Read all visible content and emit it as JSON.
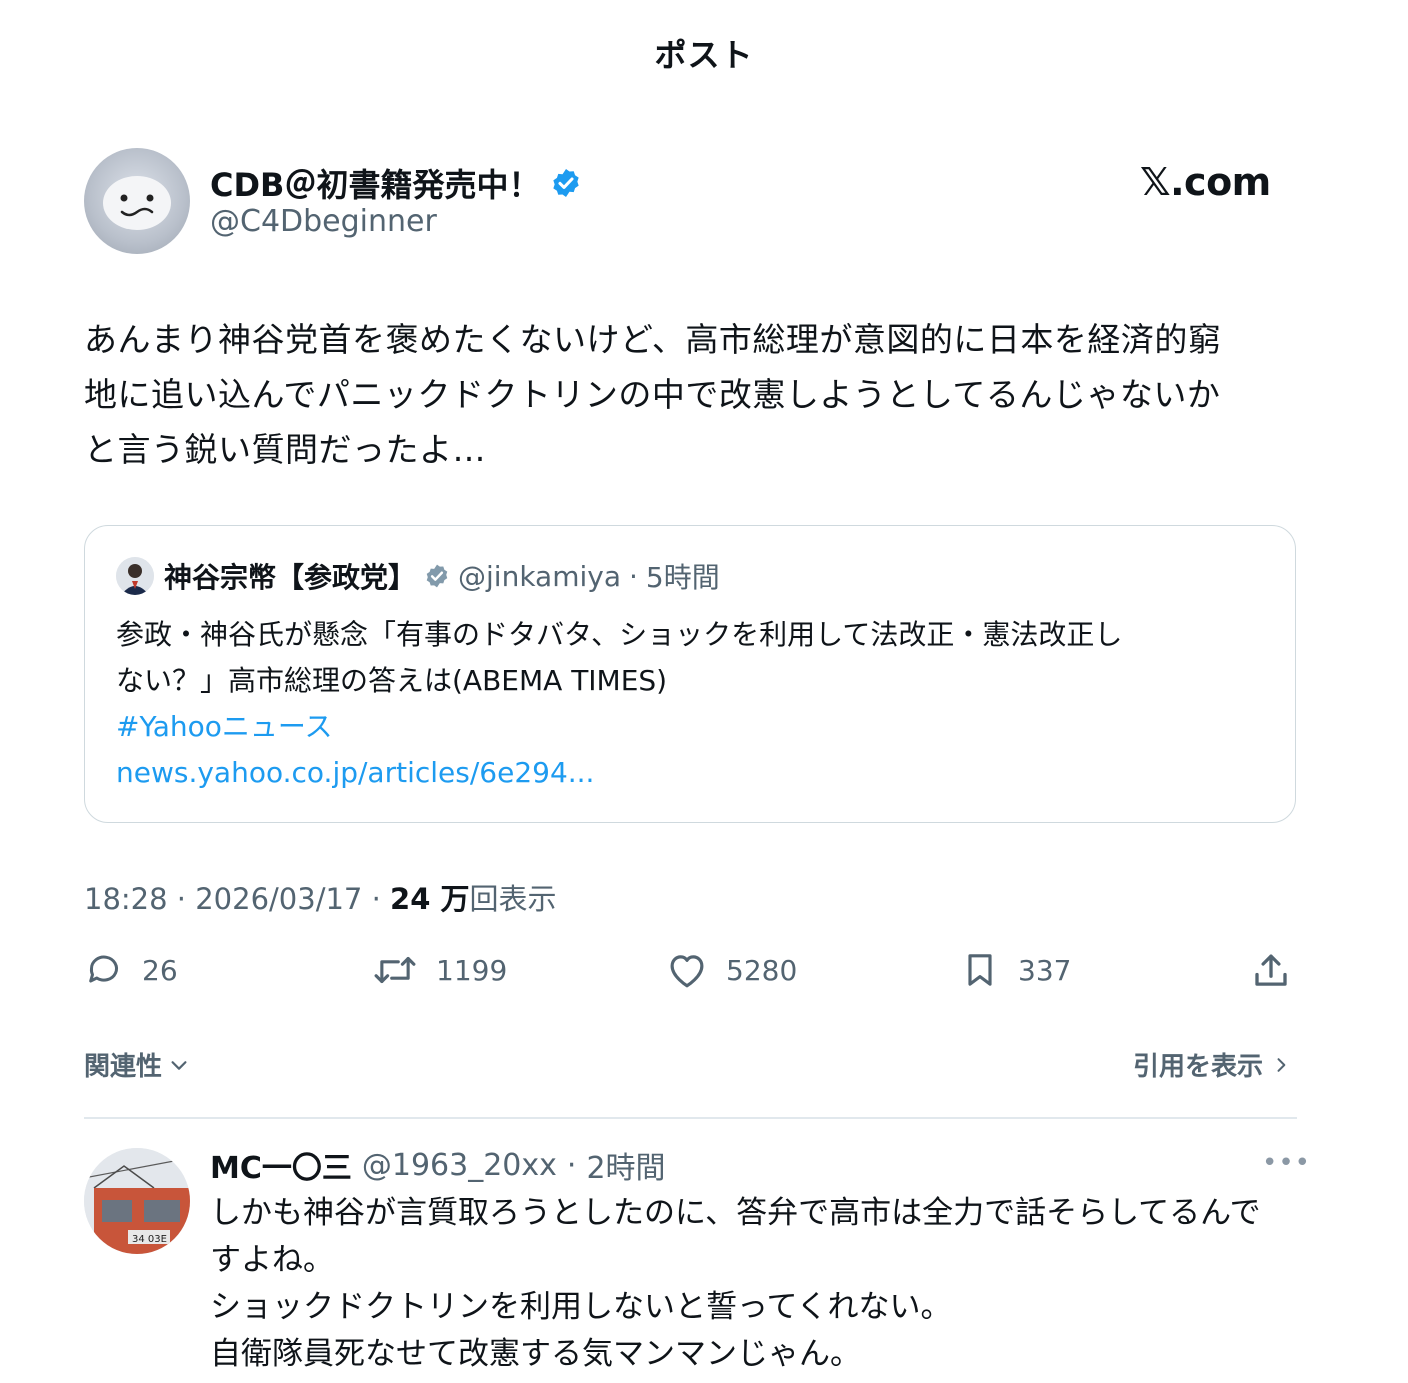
{
  "header": {
    "title": "ポスト"
  },
  "post": {
    "author": {
      "name": "CDB＠初書籍発売中！",
      "handle": "@C4Dbeginner",
      "verified": true
    },
    "brand": "𝕏.com",
    "text": "あんまり神谷党首を褒めたくないけど、高市総理が意図的に日本を経済的窮\n地に追い込んでパニックドクトリンの中で改憲しようとしてるんじゃないか\nと言う鋭い質問だったよ…",
    "quote": {
      "author": "神谷宗幣【参政党】",
      "handle": "@jinkamiya",
      "time": "5時間",
      "body_line1": "参政・神谷氏が懸念「有事のドタバタ、ショックを利用して法改正・憲法改正し",
      "body_line2": "ない？」高市総理の答えは(ABEMA TIMES)",
      "hashtag": "#Yahooニュース",
      "link": "news.yahoo.co.jp/articles/6e294..."
    },
    "meta": {
      "time": "18:28",
      "date": "2026/03/17",
      "views": "24 万",
      "views_label": "回表示"
    },
    "actions": {
      "replies": "26",
      "reposts": "1199",
      "likes": "5280",
      "bookmarks": "337"
    },
    "related_label": "関連性",
    "quotes_label": "引用を表示"
  },
  "reply": {
    "name": "MC一〇三",
    "handle": "@1963_20xx",
    "time": "2時間",
    "more": "•••",
    "lines": [
      "しかも神谷が言質取ろうとしたのに、答弁で高市は全力で話そらしてるんで",
      "すよね。",
      "ショックドクトリンを利用しないと誓ってくれない。",
      "自衛隊員死なせて改憲する気マンマンじゃん。"
    ]
  },
  "colors": {
    "text": "#0f1419",
    "secondary": "#536471",
    "link": "#1d9bf0",
    "verified": "#1d9bf0",
    "border": "#cfd9de"
  }
}
